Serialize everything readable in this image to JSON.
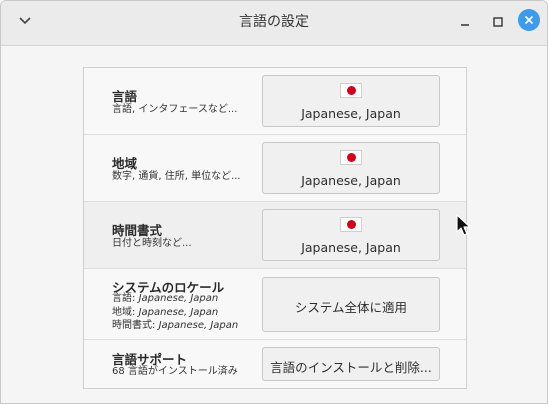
{
  "window": {
    "title": "言語の設定"
  },
  "rows": {
    "language": {
      "title": "言語",
      "subtitle": "言語, インタフェースなど...",
      "button_label": "Japanese, Japan"
    },
    "region": {
      "title": "地域",
      "subtitle": "数字, 通貨, 住所, 単位など...",
      "button_label": "Japanese, Japan"
    },
    "time_format": {
      "title": "時間書式",
      "subtitle": "日付と時刻など...",
      "button_label": "Japanese, Japan"
    },
    "system_locale": {
      "title": "システムのロケール",
      "lines": [
        {
          "label": "言語: ",
          "value": "Japanese, Japan"
        },
        {
          "label": "地域: ",
          "value": "Japanese, Japan"
        },
        {
          "label": "時間書式: ",
          "value": "Japanese, Japan"
        }
      ],
      "button_label": "システム全体に適用"
    },
    "language_support": {
      "title": "言語サポート",
      "subtitle": "68 言語がインストール済み",
      "button_label": "言語のインストールと削除..."
    }
  },
  "icons": {
    "menu": "chevron-down-icon",
    "minimize": "minimize-icon",
    "maximize": "maximize-icon",
    "close": "close-icon",
    "flag": "japan-flag-icon"
  },
  "colors": {
    "close_button": "#3d9be9",
    "flag_circle": "#d0021b"
  }
}
